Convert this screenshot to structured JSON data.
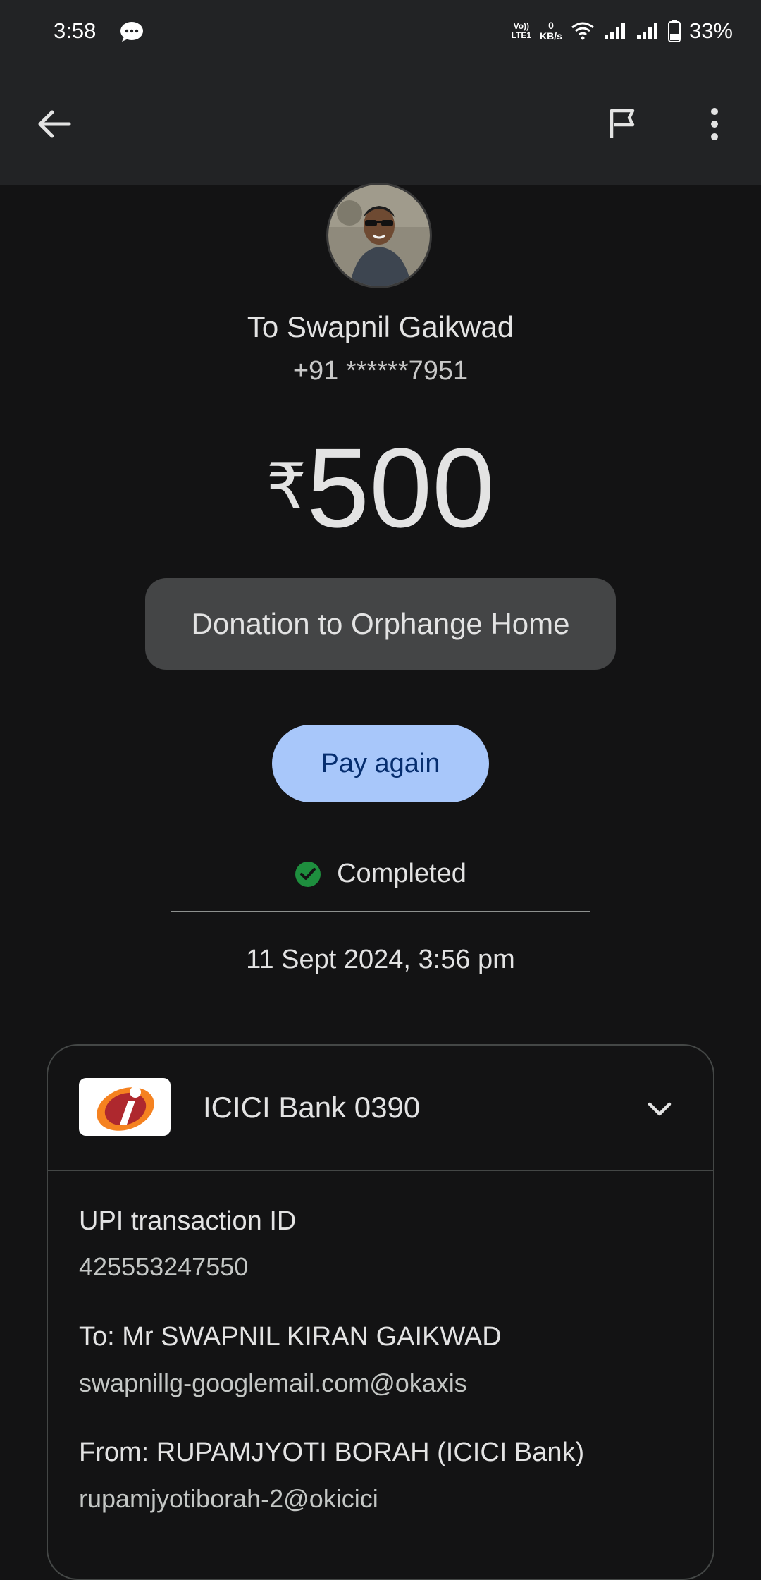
{
  "status_bar": {
    "time": "3:58",
    "network_label_1": "Vo))",
    "network_label_2": "LTE1",
    "speed_value": "0",
    "speed_unit": "KB/s",
    "battery_percent": "33%"
  },
  "header": {
    "back_icon": "arrow-left-icon",
    "flag_icon": "flag-icon",
    "more_icon": "more-vert-icon"
  },
  "payee": {
    "name": "To Swapnil Gaikwad",
    "phone": "+91 ******7951"
  },
  "amount": {
    "currency": "₹",
    "value": "500"
  },
  "note": "Donation to Orphange Home",
  "pay_again_label": "Pay again",
  "status": {
    "label": "Completed",
    "color": "#1e8e3e"
  },
  "datetime": "11 Sept 2024, 3:56 pm",
  "bank_card": {
    "bank_name": "ICICI Bank 0390",
    "details": [
      {
        "label": "UPI transaction ID",
        "value": "425553247550"
      },
      {
        "label": "To: Mr SWAPNIL KIRAN GAIKWAD",
        "value": "swapnillg-googlemail.com@okaxis"
      },
      {
        "label": "From: RUPAMJYOTI BORAH (ICICI Bank)",
        "value": "rupamjyotiborah-2@okicici"
      }
    ]
  },
  "colors": {
    "background": "#131314",
    "header": "#222325",
    "button": "#a8c7fa",
    "note_chip": "#444546"
  }
}
